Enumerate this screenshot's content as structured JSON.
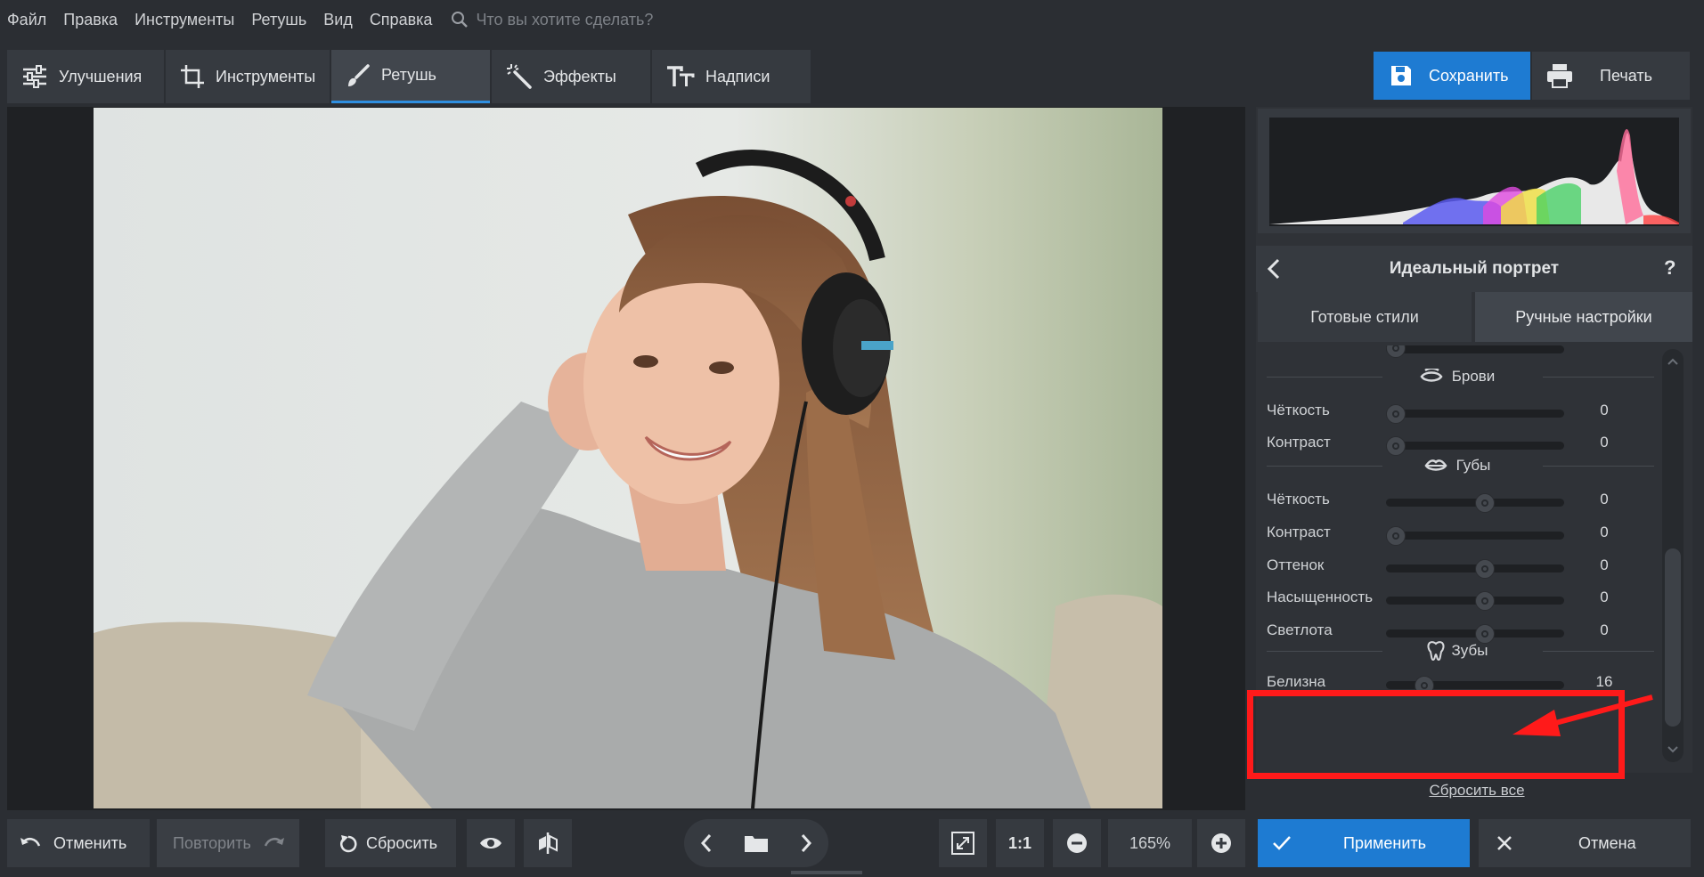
{
  "menu": [
    "Файл",
    "Правка",
    "Инструменты",
    "Ретушь",
    "Вид",
    "Справка"
  ],
  "search": {
    "placeholder": "Что вы хотите сделать?"
  },
  "tabs": [
    {
      "label": "Улучшения",
      "icon": "sliders-icon"
    },
    {
      "label": "Инструменты",
      "icon": "crop-icon"
    },
    {
      "label": "Ретушь",
      "icon": "brush-icon",
      "active": true
    },
    {
      "label": "Эффекты",
      "icon": "magic-wand-icon"
    },
    {
      "label": "Надписи",
      "icon": "text-icon"
    }
  ],
  "actions": {
    "save": "Сохранить",
    "print": "Печать"
  },
  "panel": {
    "title": "Идеальный портрет",
    "help": "?",
    "subtabs": [
      "Готовые стили",
      "Ручные настройки"
    ],
    "sections": [
      {
        "title": "Брови",
        "icon": "eyebrow-icon",
        "rows": [
          {
            "label": "Чёткость",
            "value": "0",
            "fraction": 0.0
          },
          {
            "label": "Контраст",
            "value": "0",
            "fraction": 0.0
          }
        ]
      },
      {
        "title": "Губы",
        "icon": "lips-icon",
        "rows": [
          {
            "label": "Чёткость",
            "value": "0",
            "fraction": 0.5
          },
          {
            "label": "Контраст",
            "value": "0",
            "fraction": 0.0
          },
          {
            "label": "Оттенок",
            "value": "0",
            "fraction": 0.5
          },
          {
            "label": "Насыщенность",
            "value": "0",
            "fraction": 0.5
          },
          {
            "label": "Светлота",
            "value": "0",
            "fraction": 0.5
          }
        ]
      },
      {
        "title": "Зубы",
        "icon": "tooth-icon",
        "rows": [
          {
            "label": "Белизна",
            "value": "16",
            "fraction": 0.16
          }
        ]
      }
    ],
    "reset_all": "Сбросить все"
  },
  "bottom": {
    "undo": "Отменить",
    "redo": "Повторить",
    "reset": "Сбросить",
    "zoom_fit": "1:1",
    "zoom": "165%",
    "apply": "Применить",
    "cancel": "Отмена"
  },
  "colors": {
    "accent": "#1e7bd2",
    "highlight": "#ff1a1a"
  }
}
